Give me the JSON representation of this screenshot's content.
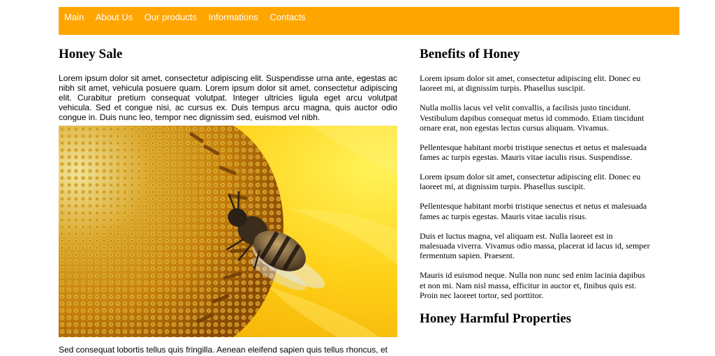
{
  "nav": {
    "items": [
      {
        "label": "Main"
      },
      {
        "label": "About Us"
      },
      {
        "label": "Our products"
      },
      {
        "label": "Informations"
      },
      {
        "label": "Contacts"
      }
    ]
  },
  "colors": {
    "nav_background": "#ffa500",
    "nav_text": "#ffffff"
  },
  "main": {
    "title": "Honey Sale",
    "intro": "Lorem ipsum dolor sit amet, consectetur adipiscing elit. Suspendisse urna ante, egestas ac nibh sit amet, vehicula posuere quam. Lorem ipsum dolor sit amet, consectetur adipiscing elit. Curabitur pretium consequat volutpat. Integer ultricies ligula eget arcu volutpat vehicula. Sed et congue nisi, ac cursus ex. Duis tempus arcu magna, quis auctor odio congue in. Duis nunc leo, tempor nec dignissim sed, euismod vel nibh.",
    "image_icon": "bee-on-sunflower-photo",
    "trailing": "Sed consequat lobortis tellus quis fringilla. Aenean eleifend sapien quis tellus rhoncus, et"
  },
  "side": {
    "title": "Benefits of Honey",
    "paragraphs": [
      "Lorem ipsum dolor sit amet, consectetur adipiscing elit. Donec eu laoreet mi, at dignissim turpis. Phasellus suscipit.",
      "Nulla mollis lacus vel velit convallis, a facilisis justo tincidunt. Vestibulum dapibus consequat metus id commodo. Etiam tincidunt ornare erat, non egestas lectus cursus aliquam. Vivamus.",
      "Pellentesque habitant morbi tristique senectus et netus et malesuada fames ac turpis egestas. Mauris vitae iaculis risus. Suspendisse.",
      "Lorem ipsum dolor sit amet, consectetur adipiscing elit. Donec eu laoreet mi, at dignissim turpis. Phasellus suscipit.",
      "Pellentesque habitant morbi tristique senectus et netus et malesuada fames ac turpis egestas. Mauris vitae iaculis risus.",
      "Duis et luctus magna, vel aliquam est. Nulla laoreet est in malesuada viverra. Vivamus odio massa, placerat id lacus id, semper fermentum sapien. Praesent.",
      "Mauris id euismod neque. Nulla non nunc sed enim lacinia dapibus et non mi. Nam nisl massa, efficitur in auctor et, finibus quis est. Proin nec laoreet tortor, sed porttitor."
    ],
    "second_title": "Honey Harmful Properties"
  }
}
